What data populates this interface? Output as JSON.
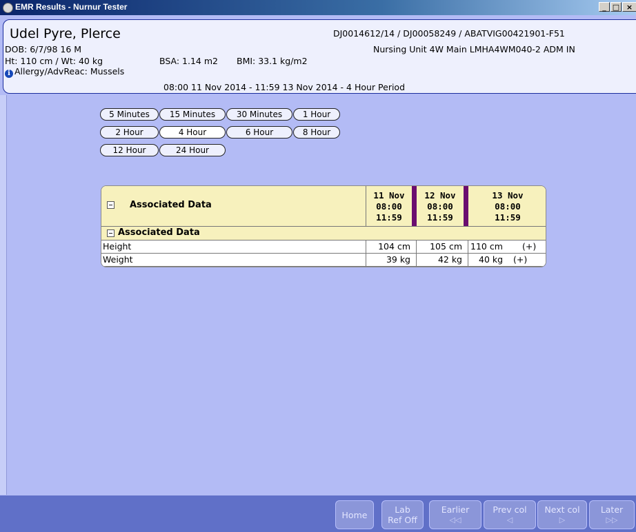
{
  "window": {
    "title": "EMR Results - Nurnur Tester",
    "buttons": [
      "_",
      "□",
      "×"
    ]
  },
  "patient": {
    "name": "Udel Pyre, Plerce",
    "ids": "DJ0014612/14 / DJ00058249 / ABATVIG00421901-F51",
    "dob": "DOB: 6/7/98 16 M",
    "location": "Nursing Unit 4W Main LMHA4WM040-2  ADM IN",
    "htwt": "Ht: 110 cm / Wt: 40 kg",
    "bsa": "BSA: 1.14 m2",
    "bmi": "BMI: 33.1 kg/m2",
    "allergy": "Allergy/AdvReac: Mussels",
    "period": "08:00 11 Nov 2014 - 11:59 13 Nov 2014 - 4 Hour Period"
  },
  "intervals": {
    "selected": "4 Hour",
    "row1": [
      "5 Minutes",
      "15 Minutes",
      "30 Minutes",
      "1 Hour"
    ],
    "row2": [
      "2 Hour",
      "4 Hour",
      "6 Hour",
      "8 Hour"
    ],
    "row3": [
      "12 Hour",
      "24 Hour"
    ]
  },
  "grid": {
    "header_label": "Associated Data",
    "section_label": "Associated Data",
    "columns": [
      {
        "date": "11 Nov",
        "start": "08:00",
        "end": "11:59"
      },
      {
        "date": "12 Nov",
        "start": "08:00",
        "end": "11:59"
      },
      {
        "date": "13 Nov",
        "start": "08:00",
        "end": "11:59"
      }
    ],
    "rows": [
      {
        "label": "Height",
        "values": [
          "104 cm",
          "105 cm",
          "110 cm"
        ],
        "flag": "(+)"
      },
      {
        "label": "Weight",
        "values": [
          "39 kg",
          "42 kg",
          "40 kg"
        ],
        "flag": "(+)"
      }
    ]
  },
  "footer": {
    "home": "Home",
    "lab_top": "Lab",
    "lab_bottom": "Ref Off",
    "earlier": "Earlier",
    "earlier_icon": "◁◁",
    "prev": "Prev col",
    "prev_icon": "◁",
    "next": "Next col",
    "next_icon": "▷",
    "later": "Later",
    "later_icon": "▷▷"
  },
  "colors": {
    "background": "#b3bbf5",
    "header_fill": "#f7f1bd",
    "purple_marker": "#6b0d6f",
    "footer": "#6070c8"
  }
}
